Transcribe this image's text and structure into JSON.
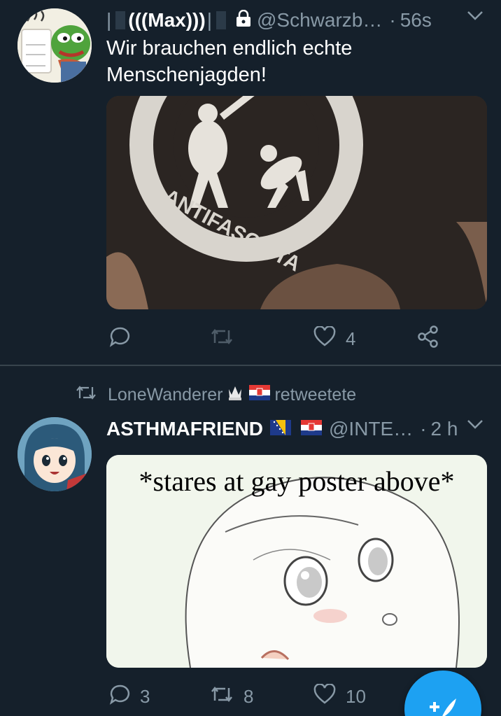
{
  "tweet1": {
    "display_name": "(((Max)))",
    "handle": "@Schwarzb…",
    "time": "56s",
    "separator": "·",
    "text": "Wir brauchen endlich echte Menschenjagden!",
    "media_caption": "ANTIFASCISTA",
    "reply_count": "",
    "retweet_count": "",
    "like_count": "4",
    "avatar": "pepe-frog-with-mug"
  },
  "retweet_banner": {
    "user": "LoneWanderer",
    "suffix": "retweetete"
  },
  "tweet2": {
    "display_name": "ASTHMAFRIEND",
    "handle": "@INTE…",
    "time": "2 h",
    "separator": "·",
    "media_caption": "*stares at gay poster above*",
    "reply_count": "3",
    "retweet_count": "8",
    "like_count": "10",
    "avatar": "anime-girl-blue-hair"
  },
  "colors": {
    "background": "#15202b",
    "secondary_text": "#8899a6",
    "divider": "#38444d",
    "accent": "#1da1f2"
  },
  "icons": [
    "lock-icon",
    "chevron-down-icon",
    "reply-icon",
    "retweet-icon",
    "like-icon",
    "share-icon",
    "compose-icon"
  ]
}
